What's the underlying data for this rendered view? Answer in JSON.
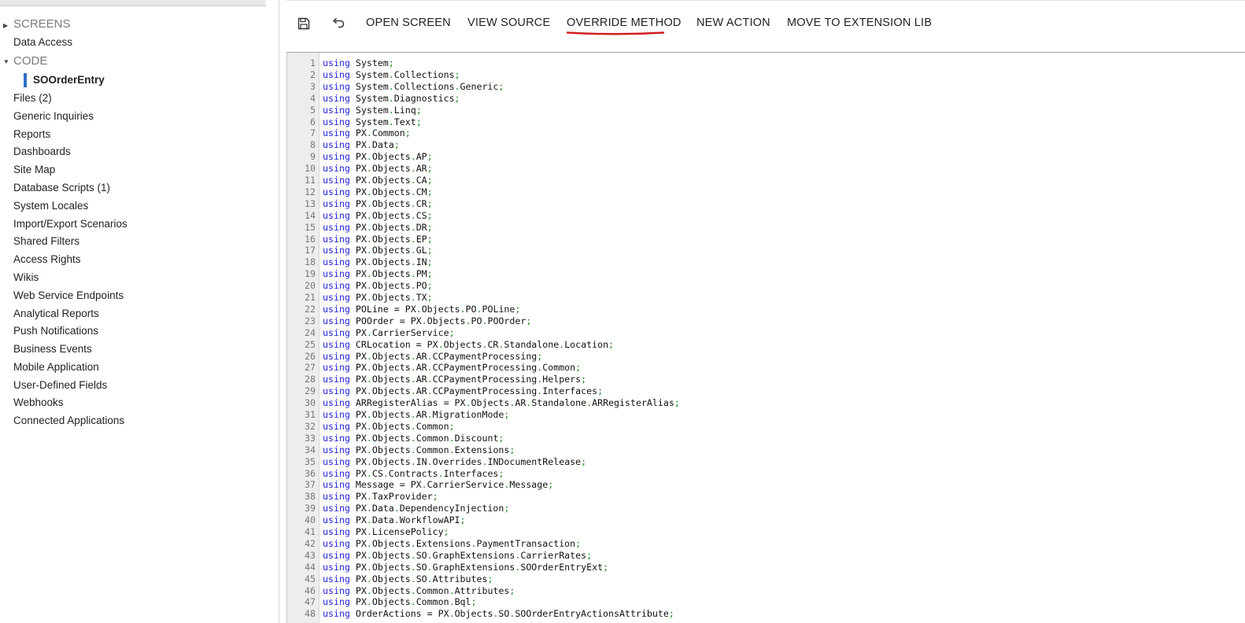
{
  "sidebar": {
    "groups": {
      "screens": "SCREENS",
      "code": "CODE"
    },
    "items": {
      "data_access": "Data Access",
      "soorderentry": "SOOrderEntry",
      "files": "Files (2)",
      "generic_inquiries": "Generic Inquiries",
      "reports": "Reports",
      "dashboards": "Dashboards",
      "site_map": "Site Map",
      "database_scripts": "Database Scripts (1)",
      "system_locales": "System Locales",
      "import_export": "Import/Export Scenarios",
      "shared_filters": "Shared Filters",
      "access_rights": "Access Rights",
      "wikis": "Wikis",
      "web_service_endpoints": "Web Service Endpoints",
      "analytical_reports": "Analytical Reports",
      "push_notifications": "Push Notifications",
      "business_events": "Business Events",
      "mobile_application": "Mobile Application",
      "user_defined_fields": "User-Defined Fields",
      "webhooks": "Webhooks",
      "connected_applications": "Connected Applications"
    }
  },
  "toolbar": {
    "save_icon": "save-icon",
    "undo_icon": "undo-icon",
    "open_screen": "OPEN SCREEN",
    "view_source": "VIEW SOURCE",
    "override_method": "OVERRIDE METHOD",
    "new_action": "NEW ACTION",
    "move_to_extension_lib": "MOVE TO EXTENSION LIB",
    "highlight_color": "#d21f1f"
  },
  "editor": {
    "keyword": "using",
    "colors": {
      "keyword": "#1f1fd8",
      "punctuation": "#1a8a1a"
    },
    "lines": [
      "System",
      "System.Collections",
      "System.Collections.Generic",
      "System.Diagnostics",
      "System.Linq",
      "System.Text",
      "PX.Common",
      "PX.Data",
      "PX.Objects.AP",
      "PX.Objects.AR",
      "PX.Objects.CA",
      "PX.Objects.CM",
      "PX.Objects.CR",
      "PX.Objects.CS",
      "PX.Objects.DR",
      "PX.Objects.EP",
      "PX.Objects.GL",
      "PX.Objects.IN",
      "PX.Objects.PM",
      "PX.Objects.PO",
      "PX.Objects.TX",
      "POLine = PX.Objects.PO.POLine",
      "POOrder = PX.Objects.PO.POOrder",
      "PX.CarrierService",
      "CRLocation = PX.Objects.CR.Standalone.Location",
      "PX.Objects.AR.CCPaymentProcessing",
      "PX.Objects.AR.CCPaymentProcessing.Common",
      "PX.Objects.AR.CCPaymentProcessing.Helpers",
      "PX.Objects.AR.CCPaymentProcessing.Interfaces",
      "ARRegisterAlias = PX.Objects.AR.Standalone.ARRegisterAlias",
      "PX.Objects.AR.MigrationMode",
      "PX.Objects.Common",
      "PX.Objects.Common.Discount",
      "PX.Objects.Common.Extensions",
      "PX.Objects.IN.Overrides.INDocumentRelease",
      "PX.CS.Contracts.Interfaces",
      "Message = PX.CarrierService.Message",
      "PX.TaxProvider",
      "PX.Data.DependencyInjection",
      "PX.Data.WorkflowAPI",
      "PX.LicensePolicy",
      "PX.Objects.Extensions.PaymentTransaction",
      "PX.Objects.SO.GraphExtensions.CarrierRates",
      "PX.Objects.SO.GraphExtensions.SOOrderEntryExt",
      "PX.Objects.SO.Attributes",
      "PX.Objects.Common.Attributes",
      "PX.Objects.Common.Bql",
      "OrderActions = PX.Objects.SO.SOOrderEntryActionsAttribute"
    ]
  }
}
